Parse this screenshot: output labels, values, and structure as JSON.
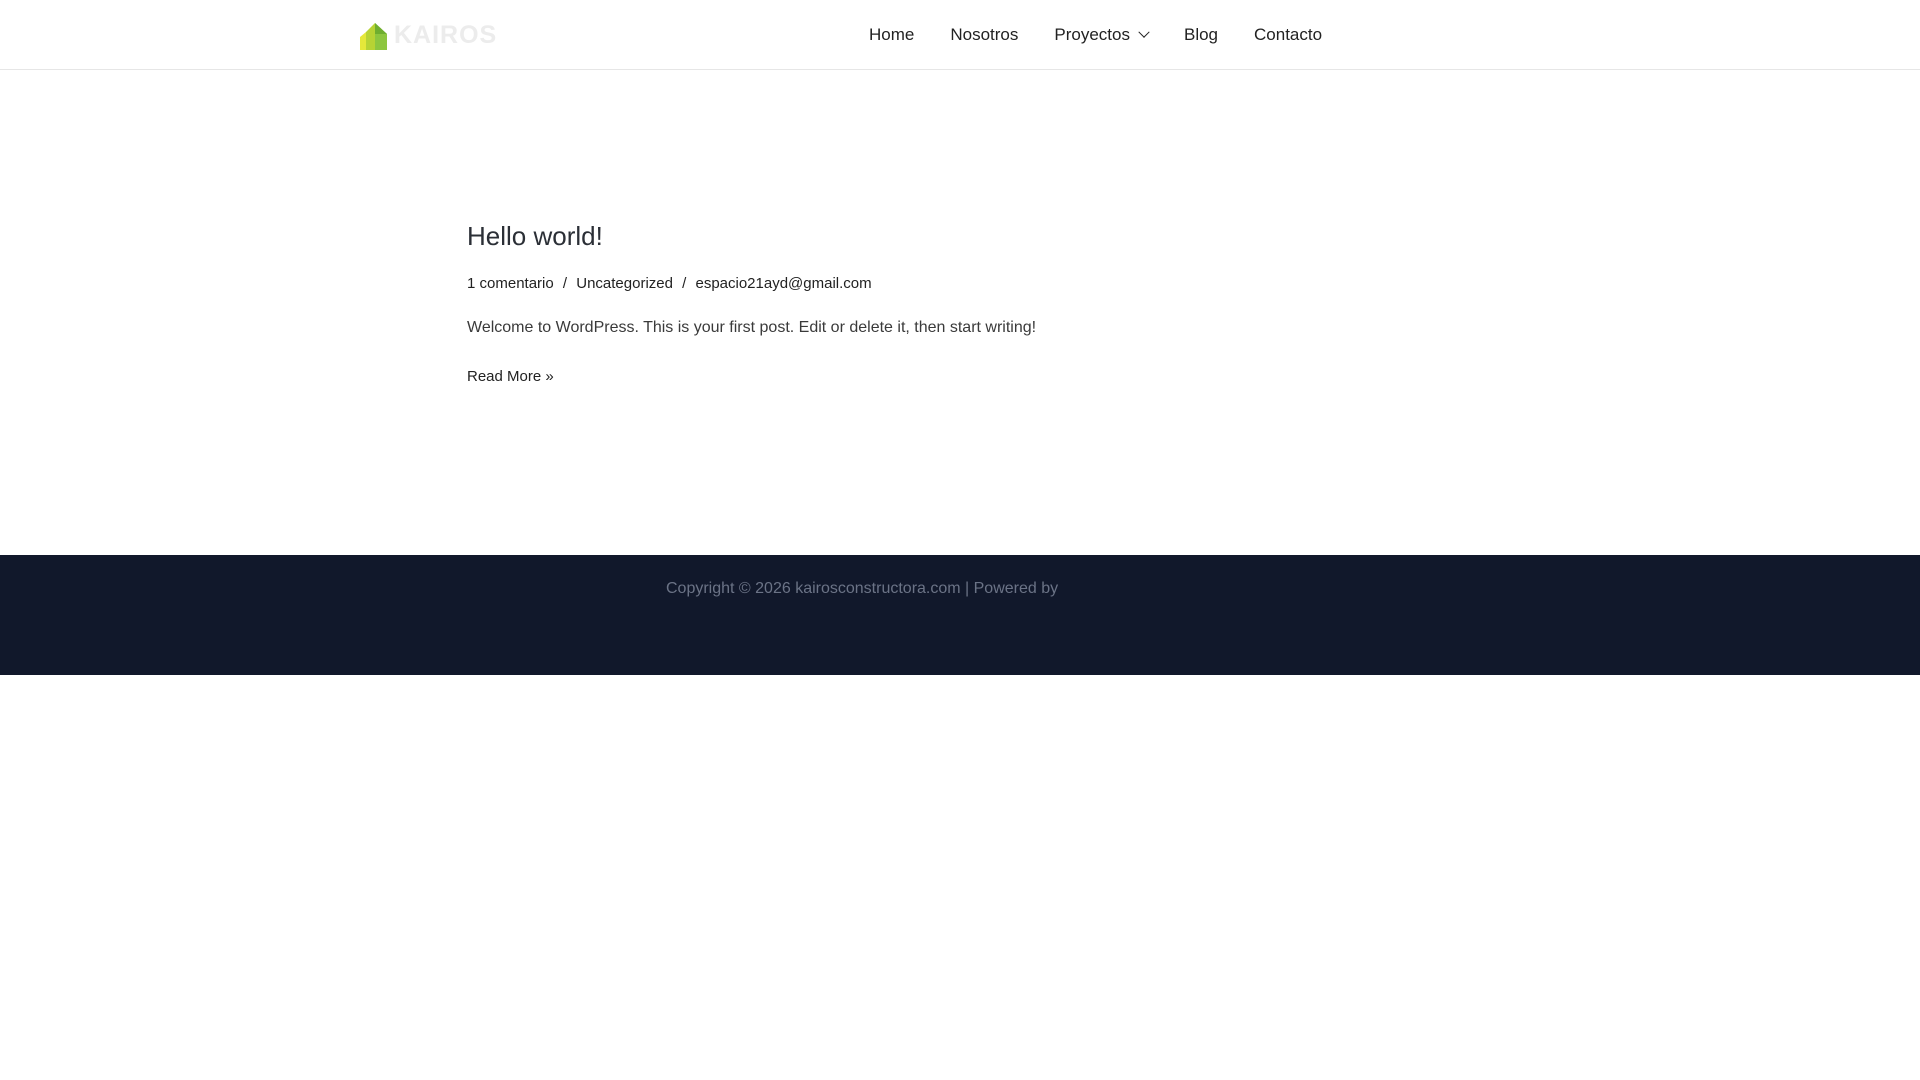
{
  "header": {
    "logo_text": "KAIROS",
    "nav": [
      {
        "label": "Home"
      },
      {
        "label": "Nosotros"
      },
      {
        "label": "Proyectos",
        "has_dropdown": true
      },
      {
        "label": "Blog"
      },
      {
        "label": "Contacto"
      }
    ]
  },
  "post": {
    "title": "Hello world!",
    "meta": {
      "comments": "1 comentario",
      "separator": "/",
      "category": "Uncategorized",
      "author": "espacio21ayd@gmail.com"
    },
    "excerpt": "Welcome to WordPress. This is your first post. Edit or delete it, then start writing!",
    "read_more": "Read More »"
  },
  "footer": {
    "copyright": "Copyright © 2026 kairosconstructora.com | Powered by"
  },
  "colors": {
    "footer_bg": "#11182b",
    "logo_green": "#8dc63f",
    "logo_yellow": "#e5e83a"
  },
  "icons": {
    "logo_mark": "house-logo-icon",
    "dropdown": "chevron-down-icon"
  }
}
